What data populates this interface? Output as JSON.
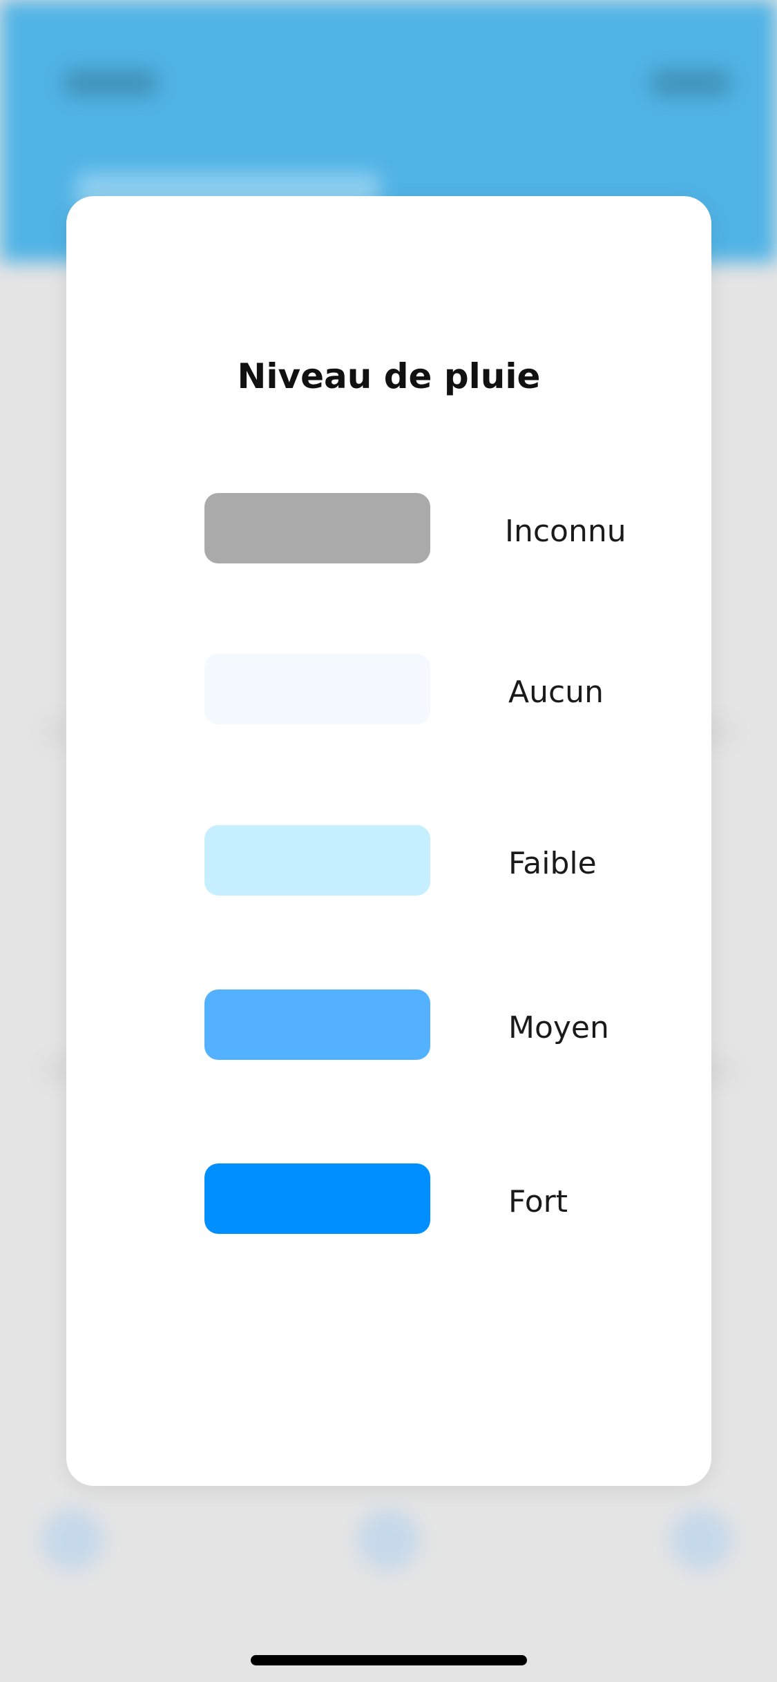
{
  "modal": {
    "title": "Niveau de pluie",
    "legend": [
      {
        "label": "Inconnu",
        "color": "#aaaaaa"
      },
      {
        "label": "Aucun",
        "color": "#f3f9ff"
      },
      {
        "label": "Faible",
        "color": "#c6efff"
      },
      {
        "label": "Moyen",
        "color": "#53b1ff"
      },
      {
        "label": "Fort",
        "color": "#008ffe"
      }
    ]
  },
  "colors": {
    "header_background": "#50b3e5",
    "overlay_background": "#e4e4e4",
    "modal_background": "#ffffff"
  }
}
